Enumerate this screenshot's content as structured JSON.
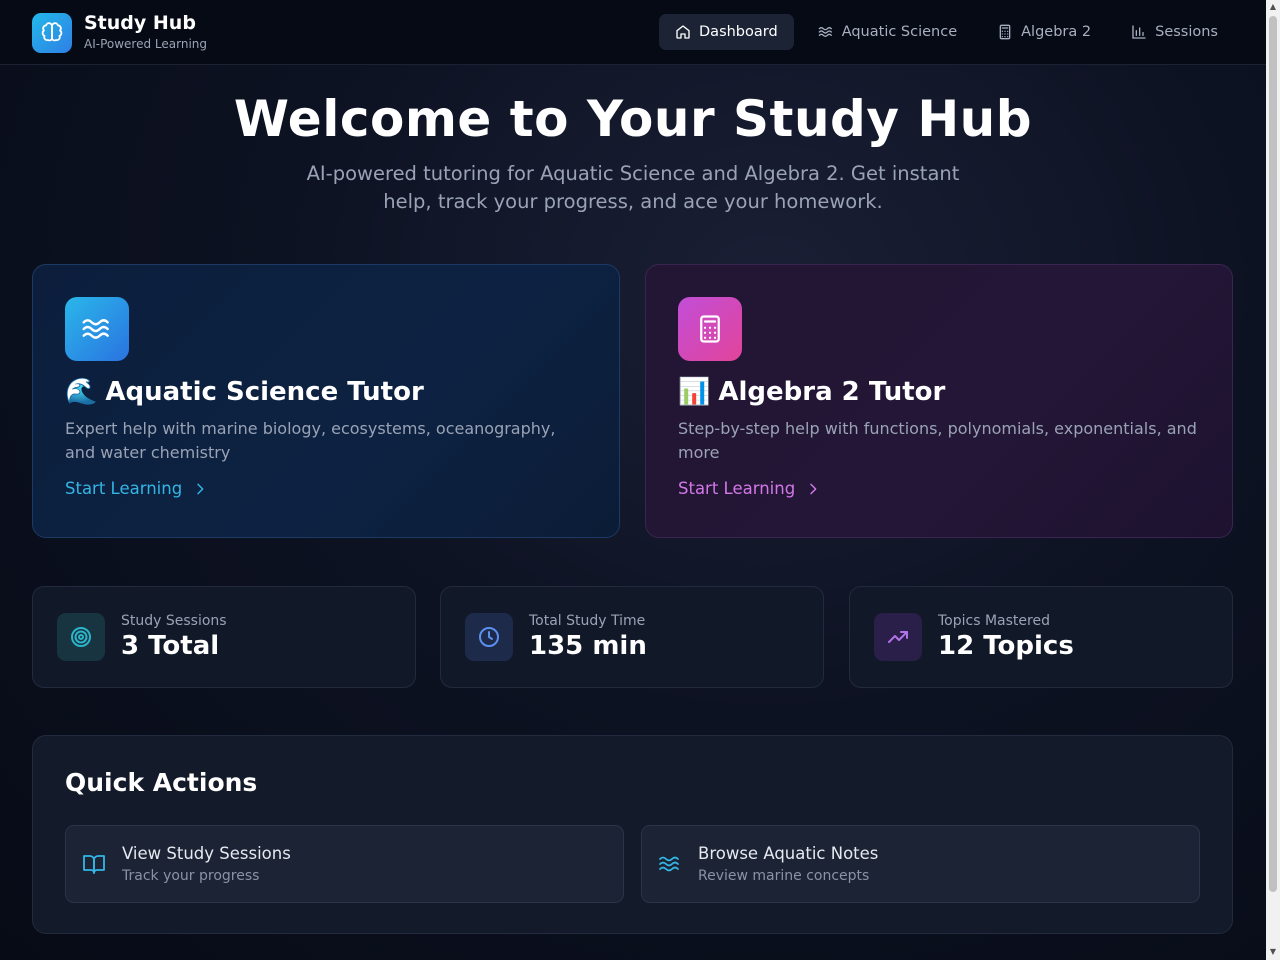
{
  "brand": {
    "title": "Study Hub",
    "subtitle": "AI-Powered Learning"
  },
  "nav": [
    {
      "label": "Dashboard",
      "icon": "home-icon",
      "active": true
    },
    {
      "label": "Aquatic Science",
      "icon": "waves-icon",
      "active": false
    },
    {
      "label": "Algebra 2",
      "icon": "calculator-icon",
      "active": false
    },
    {
      "label": "Sessions",
      "icon": "bar-chart-icon",
      "active": false
    }
  ],
  "hero": {
    "title": "Welcome to Your Study Hub",
    "subtitle": "AI-powered tutoring for Aquatic Science and Algebra 2. Get instant help, track your progress, and ace your homework."
  },
  "tutors": [
    {
      "emoji": "🌊",
      "title": "Aquatic Science Tutor",
      "description": "Expert help with marine biology, ecosystems, oceanography, and water chemistry",
      "link": "Start Learning",
      "icon": "waves-icon",
      "accent": "#33b6e6"
    },
    {
      "emoji": "📊",
      "title": "Algebra 2 Tutor",
      "description": "Step-by-step help with functions, polynomials, exponentials, and more",
      "link": "Start Learning",
      "icon": "calculator-icon",
      "accent": "#d377e8"
    }
  ],
  "stats": [
    {
      "label": "Study Sessions",
      "value": "3 Total",
      "icon": "target-icon",
      "color": "#2bb3c9"
    },
    {
      "label": "Total Study Time",
      "value": "135 min",
      "icon": "clock-icon",
      "color": "#5b8ff0"
    },
    {
      "label": "Topics Mastered",
      "value": "12 Topics",
      "icon": "trending-up-icon",
      "color": "#b272e8"
    }
  ],
  "quick_actions": {
    "title": "Quick Actions",
    "items": [
      {
        "label": "View Study Sessions",
        "description": "Track your progress",
        "icon": "book-open-icon"
      },
      {
        "label": "Browse Aquatic Notes",
        "description": "Review marine concepts",
        "icon": "waves-icon"
      }
    ]
  }
}
